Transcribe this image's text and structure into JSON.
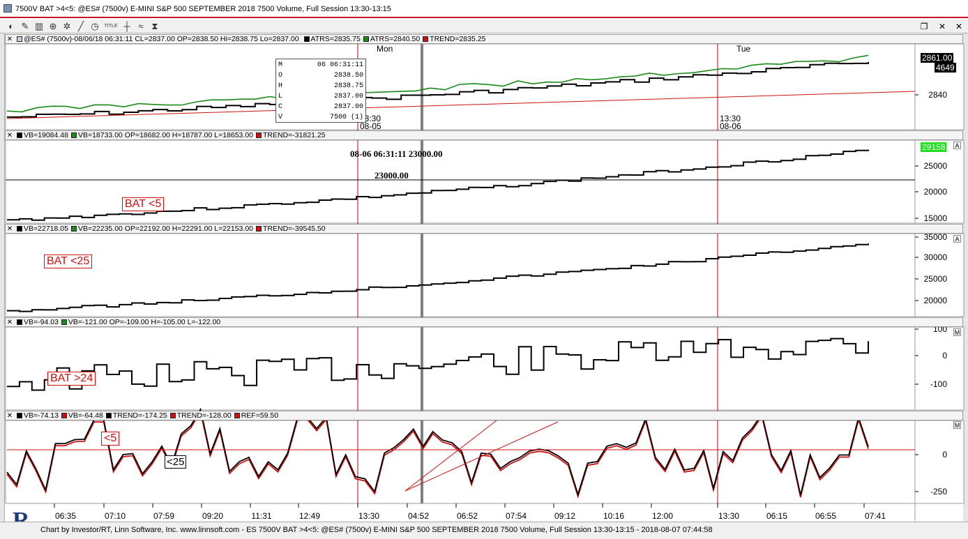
{
  "window": {
    "title": "7500V BAT >4<5: @ES# (7500v) E-MINI S&P 500 SEPTEMBER 2018 7500 Volume, Full Session 13:30-13:15",
    "icons": [
      "app-icon",
      "restore-icon",
      "close-icon"
    ]
  },
  "toolbar": {
    "icons": [
      "globe-icon",
      "edit-icon",
      "bars-icon",
      "zoom-icon",
      "gear-icon",
      "line-icon",
      "clock-icon",
      "title-icon",
      "crosshair-icon",
      "wave-icon",
      "hourglass-icon"
    ],
    "title_button": "TITLE"
  },
  "panes": {
    "p1": {
      "symbol": "@ES# (7500v)-08/06/18 06:31:11 CL=2837.00 OP=2838.50 Hi=2838.75 Lo=2837.00",
      "legend": [
        {
          "label": "ATRS=2835.75",
          "color": "#000000"
        },
        {
          "label": "ATRS=2840.50",
          "color": "#1a8a1a"
        },
        {
          "label": "TREND=2835.25",
          "color": "#d01010"
        }
      ],
      "price_badge_1": "2861.00",
      "price_badge_2": "4649",
      "axis_ticks": [
        "2840"
      ],
      "day_labels": [
        "Mon",
        "Tue"
      ],
      "session_marks": [
        {
          "time": "13:30",
          "date": "08-05"
        },
        {
          "time": "13:30",
          "date": "08-06"
        }
      ]
    },
    "ohlc_box": {
      "rows": [
        {
          "k": "M",
          "v": "06 06:31:11"
        },
        {
          "k": "O",
          "v": "2838.50"
        },
        {
          "k": "H",
          "v": "2838.75"
        },
        {
          "k": "L",
          "v": "2837.00"
        },
        {
          "k": "C",
          "v": "2837.00"
        },
        {
          "k": "V",
          "v": "7500 (1)"
        }
      ]
    },
    "p2": {
      "legend": [
        {
          "label": "VB=19084.48",
          "color": "#000000"
        },
        {
          "label": "VB=18733.00 OP=18682.00 H=18787.00 L=18653.00",
          "color": "#1a8a1a"
        },
        {
          "label": "TREND=-31821.25",
          "color": "#d01010"
        }
      ],
      "cursor_readout": "08-06 06:31:11  23000.00",
      "crosshair_value": "23000.00",
      "price_badge": "29158",
      "axis_ticks": [
        "25000",
        "20000",
        "15000"
      ],
      "bat_label": "BAT <5",
      "letter": "A"
    },
    "p3": {
      "legend": [
        {
          "label": "VB=22718.05",
          "color": "#000000"
        },
        {
          "label": "VB=22235.00 OP=22192.00 H=22291.00 L=22153.00",
          "color": "#1a8a1a"
        },
        {
          "label": "TREND=-39545.50",
          "color": "#d01010"
        }
      ],
      "axis_ticks": [
        "35000",
        "30000",
        "25000",
        "20000"
      ],
      "bat_label": "BAT <25",
      "letter": "A"
    },
    "p4": {
      "legend": [
        {
          "label": "VB=-94.03",
          "color": "#000000"
        },
        {
          "label": "VB=-121.00 OP=-109.00 H=-105.00 L=-122.00",
          "color": "#1a8a1a"
        }
      ],
      "axis_ticks": [
        "100",
        "0",
        "-100"
      ],
      "bat_label": "BAT >24",
      "letter": "M"
    },
    "p5": {
      "legend": [
        {
          "label": "VB=-74.13",
          "color": "#000000"
        },
        {
          "label": "VB=-64.48",
          "color": "#d01010"
        },
        {
          "label": "TREND=-174.25",
          "color": "#000000"
        },
        {
          "label": "TREND=-128.00",
          "color": "#d01010"
        },
        {
          "label": "REF=59.50",
          "color": "#d01010"
        }
      ],
      "axis_ticks": [
        "0",
        "-250"
      ],
      "label_lt5": "<5",
      "label_lt25": "<25",
      "letter": "M"
    }
  },
  "time_axis": [
    "06:35",
    "07:10",
    "07:59",
    "09:20",
    "11:31",
    "12:49",
    "13:30",
    "04:52",
    "06:52",
    "07:54",
    "09:12",
    "10:16",
    "12:00",
    "13:30",
    "06:15",
    "06:55",
    "07:41"
  ],
  "status": "Chart by Investor/RT, Linn Software, Inc. www.linnsoft.com - ES 7500V BAT >4<5: @ES# (7500v) E-MINI S&P 500 SEPTEMBER 2018 7500 Volume, Full Session 13:30-13:15 - 2018-08-07 07:44:58",
  "colors": {
    "black_line": "#000000",
    "green_line": "#1a8a1a",
    "red_line": "#d01010",
    "session_line": "#c00000",
    "cursor_bar": "#808080"
  }
}
